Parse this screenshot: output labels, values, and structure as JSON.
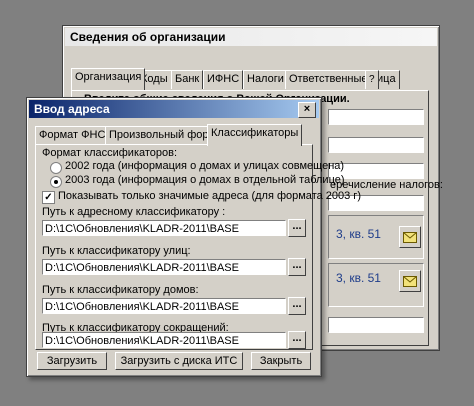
{
  "org_window": {
    "title": "Сведения об организации",
    "tabs": [
      "Организация",
      "Коды",
      "Банк",
      "ИФНС",
      "Налоги",
      "Ответственные лица"
    ],
    "header": "Введите общие сведения о Вашей Организации.",
    "tax_transfer_label": "еречисление налогов:",
    "address_1": "3, кв. 51",
    "address_2": "3, кв. 51",
    "help_glyph": "?"
  },
  "dialog": {
    "title": "Ввод адреса",
    "close_glyph": "×",
    "tabs": [
      "Формат ФНС",
      "Произвольный формат",
      "Классификаторы"
    ],
    "classifier_format_label": "Формат классификаторов:",
    "radio_2002": "2002 года (информация о домах и улицах совмещена)",
    "radio_2003": "2003 года (информация о домах в отдельной таблице)",
    "checkbox_label": "Показывать только значимые адреса (для формата 2003 г)",
    "address_label": "Путь к  адресному классификатору :",
    "address_path": "D:\\1C\\Обновления\\KLADR-2011\\BASE",
    "streets_label": "Путь к классификатору улиц:",
    "streets_path": "D:\\1C\\Обновления\\KLADR-2011\\BASE",
    "houses_label": "Путь к классификатору домов:",
    "houses_path": "D:\\1C\\Обновления\\KLADR-2011\\BASE",
    "abbr_label": "Путь к классификатору сокращений:",
    "abbr_path": "D:\\1C\\Обновления\\KLADR-2011\\BASE",
    "browse_glyph": "...",
    "load_button": "Загрузить",
    "load_its_button": "Загрузить с диска ИТС",
    "close_button": "Закрыть"
  }
}
